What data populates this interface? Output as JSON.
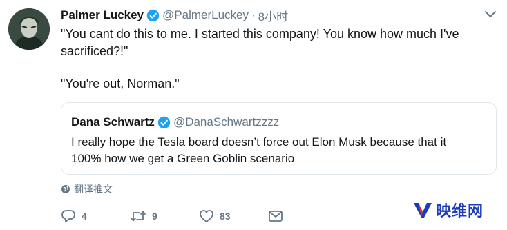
{
  "tweet": {
    "author_name": "Palmer Luckey",
    "author_handle": "@PalmerLuckey",
    "separator": "·",
    "time": "8小时",
    "lines": [
      "\"You cant do this to me. I started this company! You know how much I've",
      "sacrificed?!\"",
      "\"You're out, Norman.\""
    ]
  },
  "quote": {
    "author_name": "Dana Schwartz",
    "author_handle": "@DanaSchwartzzzz",
    "lines": [
      "I really hope the Tesla board doesn’t force out Elon Musk because that it",
      "100% how we get a Green Goblin scenario"
    ]
  },
  "translate_label": "翻译推文",
  "actions": {
    "reply_count": "4",
    "retweet_count": "9",
    "like_count": "83"
  },
  "watermark": {
    "text": "映维网"
  },
  "colors": {
    "verified": "#1da1f2",
    "muted": "#657786",
    "watermark": "#1a3cb8"
  }
}
